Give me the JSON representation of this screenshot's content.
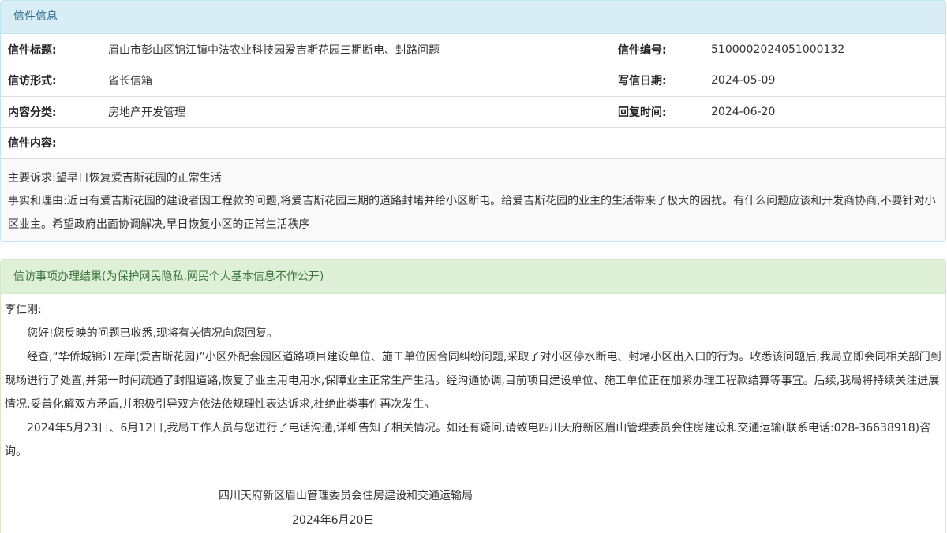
{
  "letter_panel": {
    "heading": "信件信息",
    "rows": [
      {
        "label1": "信件标题:",
        "value1": "眉山市彭山区锦江镇中法农业科技园爱吉斯花园三期断电、封路问题",
        "label2": "信件编号:",
        "value2": "5100002024051000132"
      },
      {
        "label1": "信访形式:",
        "value1": "省长信箱",
        "label2": "写信日期:",
        "value2": "2024-05-09"
      },
      {
        "label1": "内容分类:",
        "value1": "房地产开发管理",
        "label2": "回复时间:",
        "value2": "2024-06-20"
      }
    ],
    "content_label": "信件内容:",
    "content_lines": [
      "主要诉求:望早日恢复爱吉斯花园的正常生活",
      "事实和理由:近日有爱吉斯花园的建设者因工程款的问题,将爱吉斯花园三期的道路封堵并给小区断电。给爱吉斯花园的业主的生活带来了极大的困扰。有什么问题应该和开发商协商,不要针对小区业主。希望政府出面协调解决,早日恢复小区的正常生活秩序"
    ]
  },
  "result_panel": {
    "heading": "信访事项办理结果(为保护网民隐私,网民个人基本信息不作公开)",
    "salutation": "李仁刚:",
    "paragraphs": [
      "您好!您反映的问题已收悉,现将有关情况向您回复。",
      "经查,“华侨城锦江左岸(爱吉斯花园)”小区外配套园区道路项目建设单位、施工单位因合同纠纷问题,采取了对小区停水断电、封堵小区出入口的行为。收悉该问题后,我局立即会同相关部门到现场进行了处置,并第一时间疏通了封阻道路,恢复了业主用电用水,保障业主正常生产生活。经沟通协调,目前项目建设单位、施工单位正在加紧办理工程款结算等事宜。后续,我局将持续关注进展情况,妥善化解双方矛盾,并积极引导双方依法依规理性表达诉求,杜绝此类事件再次发生。",
      "2024年5月23日、6月12日,我局工作人员与您进行了电话沟通,详细告知了相关情况。如还有疑问,请致电四川天府新区眉山管理委员会住房建设和交通运输(联系电话:028-36638918)咨询。"
    ],
    "signature_org": "四川天府新区眉山管理委员会住房建设和交通运输局",
    "signature_date": "2024年6月20日"
  },
  "colors": {
    "info_heading_bg": "#d9edf7",
    "info_heading_text": "#31708f",
    "success_heading_bg": "#dff0d8",
    "success_heading_text": "#3c763d"
  }
}
